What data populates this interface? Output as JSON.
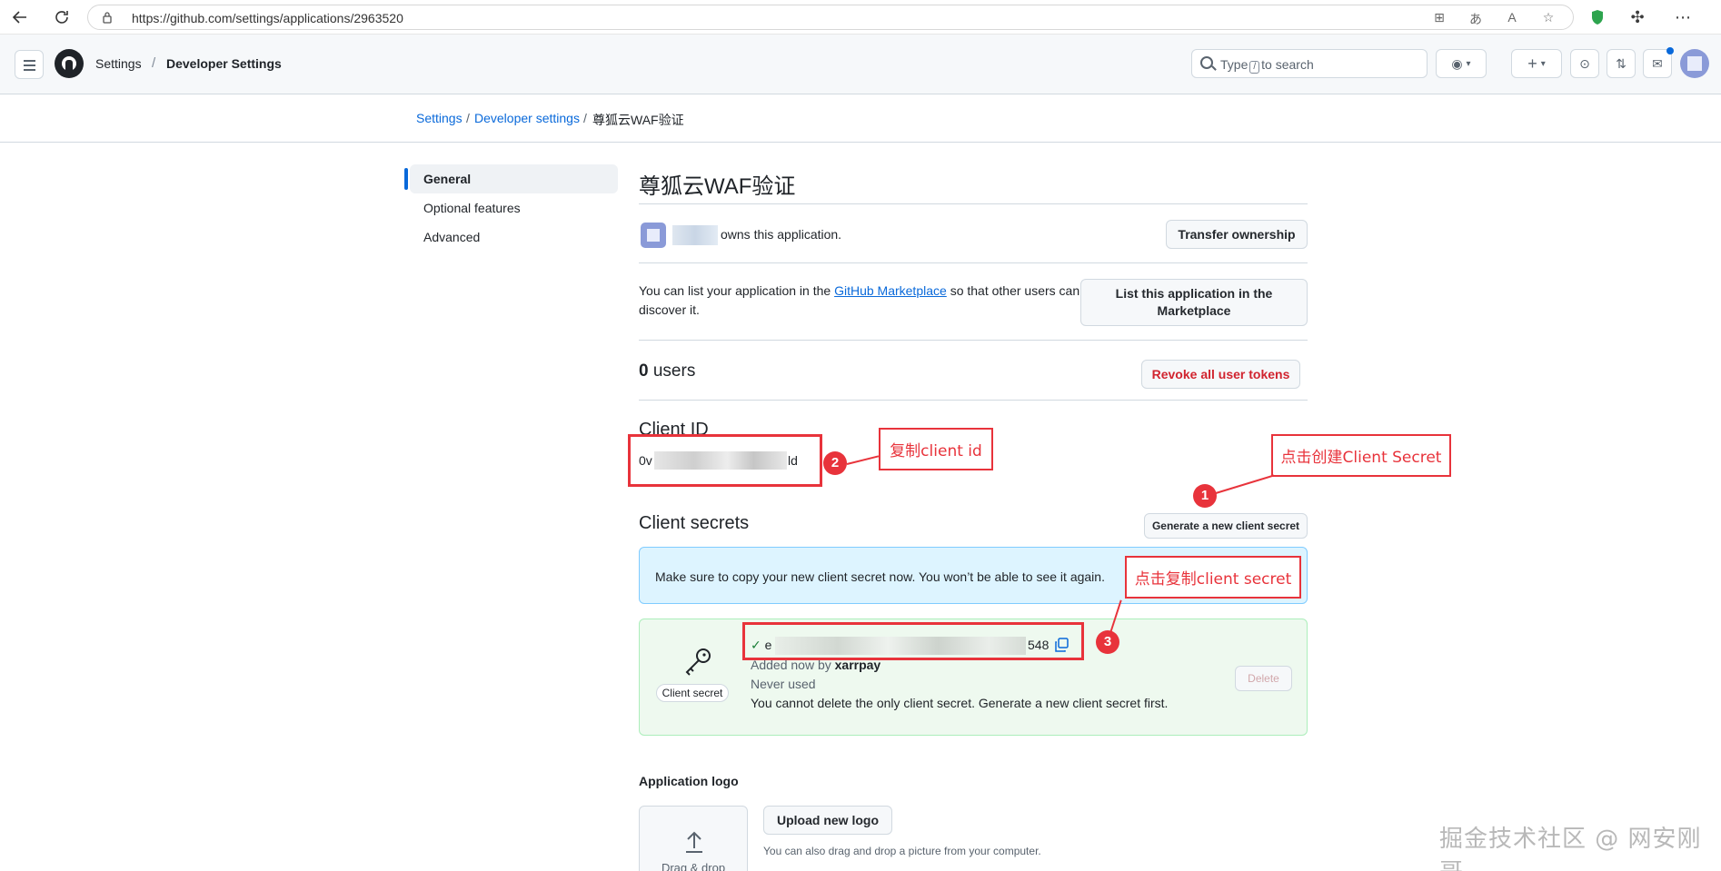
{
  "browser": {
    "url": "https://github.com/settings/applications/2963520"
  },
  "header": {
    "crumb_settings": "Settings",
    "crumb_sep": "/",
    "crumb_developer": "Developer Settings",
    "search_prefix": "Type",
    "search_key": "/",
    "search_suffix": "to search"
  },
  "breadcrumb": {
    "settings": "Settings",
    "developer": "Developer settings",
    "app": "尊狐云WAF验证",
    "sep": "/"
  },
  "sidebar": {
    "items": [
      {
        "label": "General",
        "active": true
      },
      {
        "label": "Optional features",
        "active": false
      },
      {
        "label": "Advanced",
        "active": false
      }
    ]
  },
  "main": {
    "title": "尊狐云WAF验证",
    "owns_text": "owns this application.",
    "transfer_button": "Transfer ownership",
    "market_text_1": "You can list your application in the",
    "market_link": "GitHub Marketplace",
    "market_text_2": "so that other users can discover it.",
    "market_button": "List this application in the Marketplace",
    "users_count": "0",
    "users_label": "users",
    "revoke_button": "Revoke all user tokens",
    "client_id_title": "Client ID",
    "client_id_start": "0v",
    "client_id_end": "ld",
    "client_secrets_title": "Client secrets",
    "generate_button": "Generate a new client secret",
    "flash_text": "Make sure to copy your new client secret now. You won’t be able to see it again.",
    "secret_label": "Client secret",
    "secret_start": "e",
    "secret_end": "548",
    "added_text": "Added now by",
    "added_user": "xarrpay",
    "never_used": "Never used",
    "cannot_delete": "You cannot delete the only client secret. Generate a new client secret first.",
    "delete_button": "Delete",
    "logo_title": "Application logo",
    "upload_button": "Upload new logo",
    "drag_hint": "You can also drag and drop a picture from your computer.",
    "drop_text": "Drag & drop"
  },
  "annotations": {
    "copy_client_id": "复制client id",
    "create_secret": "点击创建Client Secret",
    "copy_secret": "点击复制client secret",
    "n1": "1",
    "n2": "2",
    "n3": "3"
  },
  "watermark": "掘金技术社区 @ 网安刚哥",
  "colors": {
    "accent": "#0969da",
    "danger": "#d1242f",
    "annotation": "#e8333b",
    "success_bg": "#eef9ef",
    "flash_bg": "#ddf4ff"
  }
}
